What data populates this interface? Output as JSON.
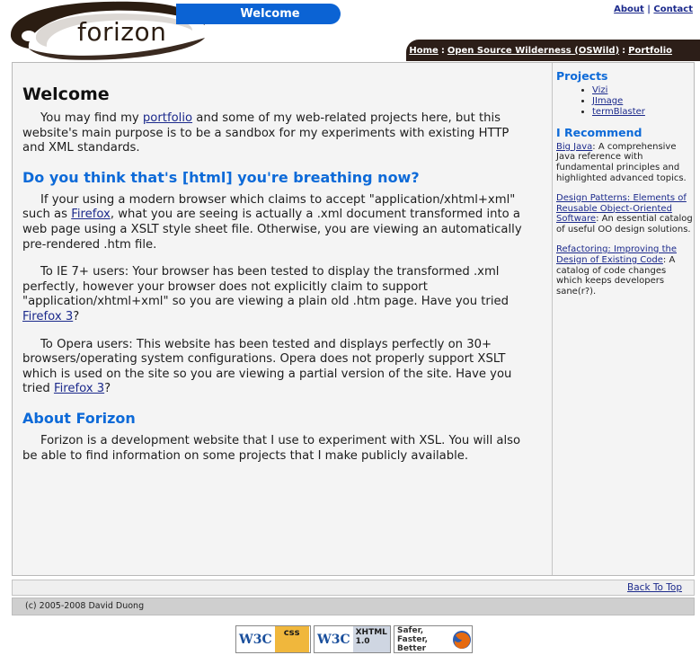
{
  "header": {
    "logo_text": "forizon",
    "page_title": "Welcome",
    "top_links": {
      "about": "About",
      "separator": "|",
      "contact": "Contact"
    },
    "breadcrumb": {
      "home": "Home",
      "sep1": ":",
      "oswild": "Open Source Wilderness (OSWild)",
      "sep2": ":",
      "portfolio": "Portfolio"
    }
  },
  "main": {
    "heading": "Welcome",
    "intro": {
      "before": "You may find my ",
      "link": "portfolio",
      "after": " and some of my web-related projects here, but this website's main purpose is to be a sandbox for my experiments with existing HTTP and XML standards."
    },
    "section1_heading": "Do you think that's [html] you're breathing now?",
    "p1": {
      "before": "If your using a modern browser which claims to accept \"application/xhtml+xml\" such as ",
      "link": "Firefox",
      "after": ", what you are seeing is actually a .xml document transformed into a web page using a XSLT style sheet file. Otherwise, you are viewing an automatically pre-rendered .htm file."
    },
    "p2": {
      "before": "To IE 7+ users: Your browser has been tested to display the transformed .xml perfectly, however your browser does not explicitly claim to support \"application/xhtml+xml\" so you are viewing a plain old .htm page. Have you tried ",
      "link": "Firefox 3",
      "after": "?"
    },
    "p3": {
      "before": "To Opera users: This website has been tested and displays perfectly on 30+ browsers/operating system configurations. Opera does not properly support XSLT which is used on the site so you are viewing a partial version of the site. Have you tried ",
      "link": "Firefox 3",
      "after": "?"
    },
    "section2_heading": "About Forizon",
    "p4": "Forizon is a development website that I use to experiment with XSL. You will also be able to find information on some projects that I make publicly available."
  },
  "sidebar": {
    "projects_heading": "Projects",
    "projects": [
      "Vizi",
      "JImage",
      "termBlaster"
    ],
    "recommend_heading": "I Recommend",
    "recommendations": [
      {
        "title": "Big Java",
        "desc": ": A comprehensive Java reference with fundamental principles and highlighted advanced topics."
      },
      {
        "title": "Design Patterns: Elements of Reusable Object-Oriented Software",
        "desc": ": An essential catalog of useful OO design solutions."
      },
      {
        "title": "Refactoring: Improving the Design of Existing Code",
        "desc": ": A catalog of code changes which keeps developers sane(r?)."
      }
    ]
  },
  "footer": {
    "back_to_top": "Back To Top",
    "copyright": "(c) 2005-2008 David Duong"
  },
  "badges": {
    "w3c": "W3C",
    "css": "css",
    "xhtml": "XHTML",
    "xhtml_version": "1.0",
    "firefox_line1": "Safer, Faster,",
    "firefox_line2": "Better"
  },
  "colors": {
    "accent_blue": "#0b63d4",
    "heading_blue": "#0d6ad8",
    "dark_brown": "#2c1e18",
    "link": "#1c2a8c"
  }
}
